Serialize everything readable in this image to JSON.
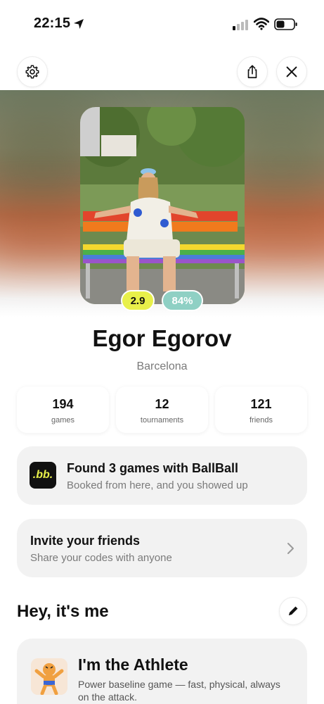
{
  "status_bar": {
    "time": "22:15"
  },
  "profile": {
    "level": "2.9",
    "reliability": "84%",
    "name": "Egor Egorov",
    "city": "Barcelona"
  },
  "stats": [
    {
      "value": "194",
      "label": "games"
    },
    {
      "value": "12",
      "label": "tournaments"
    },
    {
      "value": "121",
      "label": "friends"
    }
  ],
  "ballball_card": {
    "logo_text": ".bb.",
    "title": "Found 3 games with BallBall",
    "subtitle": "Booked from here, and you showed up"
  },
  "invite_card": {
    "title": "Invite your friends",
    "subtitle": "Share your codes with anyone"
  },
  "about": {
    "section_title": "Hey, it's me",
    "persona_title": "I'm the Athlete",
    "persona_desc": "Power baseline game — fast, physical, always on the attack."
  },
  "icons": {
    "settings": "gear-icon",
    "share": "share-icon",
    "close": "close-icon",
    "edit": "pencil-icon",
    "chevron": "chevron-right-icon"
  },
  "colors": {
    "level_pill": "#e8f04a",
    "reliability_pill": "#8fd0c4",
    "card_bg": "#f2f2f2",
    "bb_logo_bg": "#111111"
  }
}
